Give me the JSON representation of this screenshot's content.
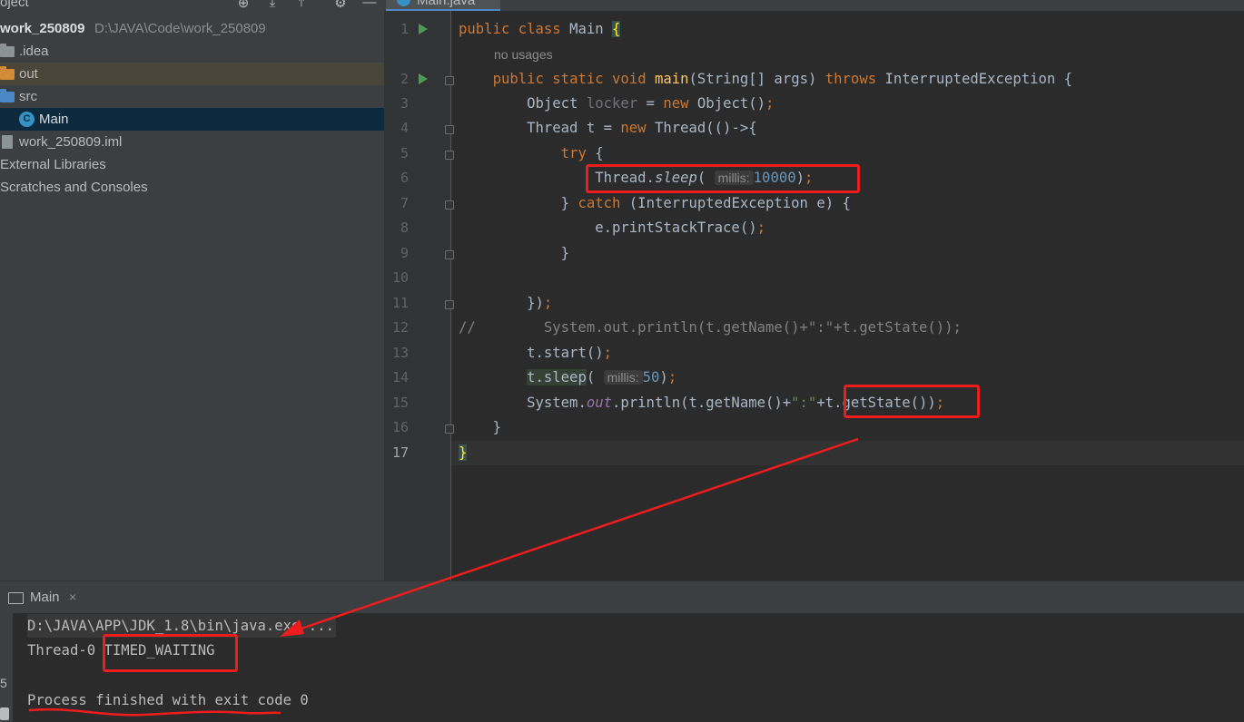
{
  "project": {
    "header_title": "oject",
    "root_name": "work_250809",
    "root_path": "D:\\JAVA\\Code\\work_250809",
    "items": [
      {
        "label": ".idea"
      },
      {
        "label": "out"
      },
      {
        "label": "src"
      },
      {
        "label": "Main"
      },
      {
        "label": "work_250809.iml"
      },
      {
        "label": "External Libraries"
      },
      {
        "label": "Scratches and Consoles"
      }
    ]
  },
  "editor": {
    "tab_label": "Main.java",
    "line_numbers": [
      "1",
      "2",
      "3",
      "4",
      "5",
      "6",
      "7",
      "8",
      "9",
      "10",
      "11",
      "12",
      "13",
      "14",
      "15",
      "16",
      "17"
    ],
    "usages_hint": "no usages",
    "tokens": {
      "public": "public",
      "class": "class",
      "main_class": "Main",
      "brace_open": "{",
      "static": "static",
      "void": "void",
      "main": "main",
      "string_args": "(String[] args) ",
      "throws": "throws",
      "interrupted_ex": " InterruptedException {",
      "object": "Object ",
      "locker": "locker",
      "eq_new": " = ",
      "new": "new",
      "object_ctor": " Object()",
      "semi": ";",
      "thread_t": "Thread t = ",
      "thread_ctor": " Thread(()->{",
      "try": "try",
      "try_brace": " {",
      "thread_dot": "Thread.",
      "sleep": "sleep",
      "open_paren": "(",
      "millis_hint": "millis:",
      "val_10000": "10000",
      "close_paren": ")",
      "catch_open": "} ",
      "catch": "catch",
      "catch_rest": " (InterruptedException e) {",
      "print_stack": "e.printStackTrace()",
      "close_brace": "}",
      "close_lambda": "})",
      "comment_line": "//        System.out.println(t.getName()+\":\"+t.getState());",
      "t_start": "t.start()",
      "t_sleep": "t.sleep",
      "val_50": "50",
      "system_dot": "System.",
      "out": "out",
      "println_get_name": ".println(t.getName()+",
      "colon_str": "\":\"",
      "get_state": "+t.getState())",
      "class_close": "}"
    }
  },
  "run": {
    "tab_label": "Main",
    "close_glyph": "×",
    "cmd_line": "D:\\JAVA\\APP\\JDK_1.8\\bin\\java.exe ...",
    "thread_name": "Thread-0 ",
    "state": "TIMED_WAITING",
    "finish_line": "Process finished with exit code 0"
  },
  "colors": {
    "annotation_red": "#ee1c1c",
    "keyword": "#cc7832",
    "number": "#6897bb",
    "string": "#6a8759"
  }
}
